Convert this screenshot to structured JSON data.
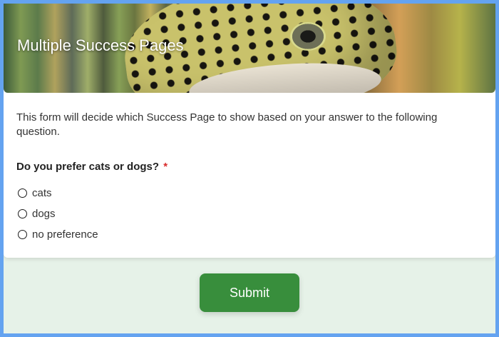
{
  "form": {
    "title": "Multiple Success Pages",
    "description": "This form will decide which Success Page to show based on your answer to the following question.",
    "question": {
      "label": "Do you prefer cats or dogs?",
      "required_marker": "*",
      "options": [
        {
          "label": "cats",
          "selected": false
        },
        {
          "label": "dogs",
          "selected": false
        },
        {
          "label": "no preference",
          "selected": false
        }
      ]
    },
    "submit_label": "Submit"
  },
  "colors": {
    "frame_border": "#64a3f0",
    "page_background": "#e6f2e8",
    "submit_button": "#388e3c",
    "required_marker": "#d92c2c"
  },
  "header_image": "leopard-gecko-banner"
}
